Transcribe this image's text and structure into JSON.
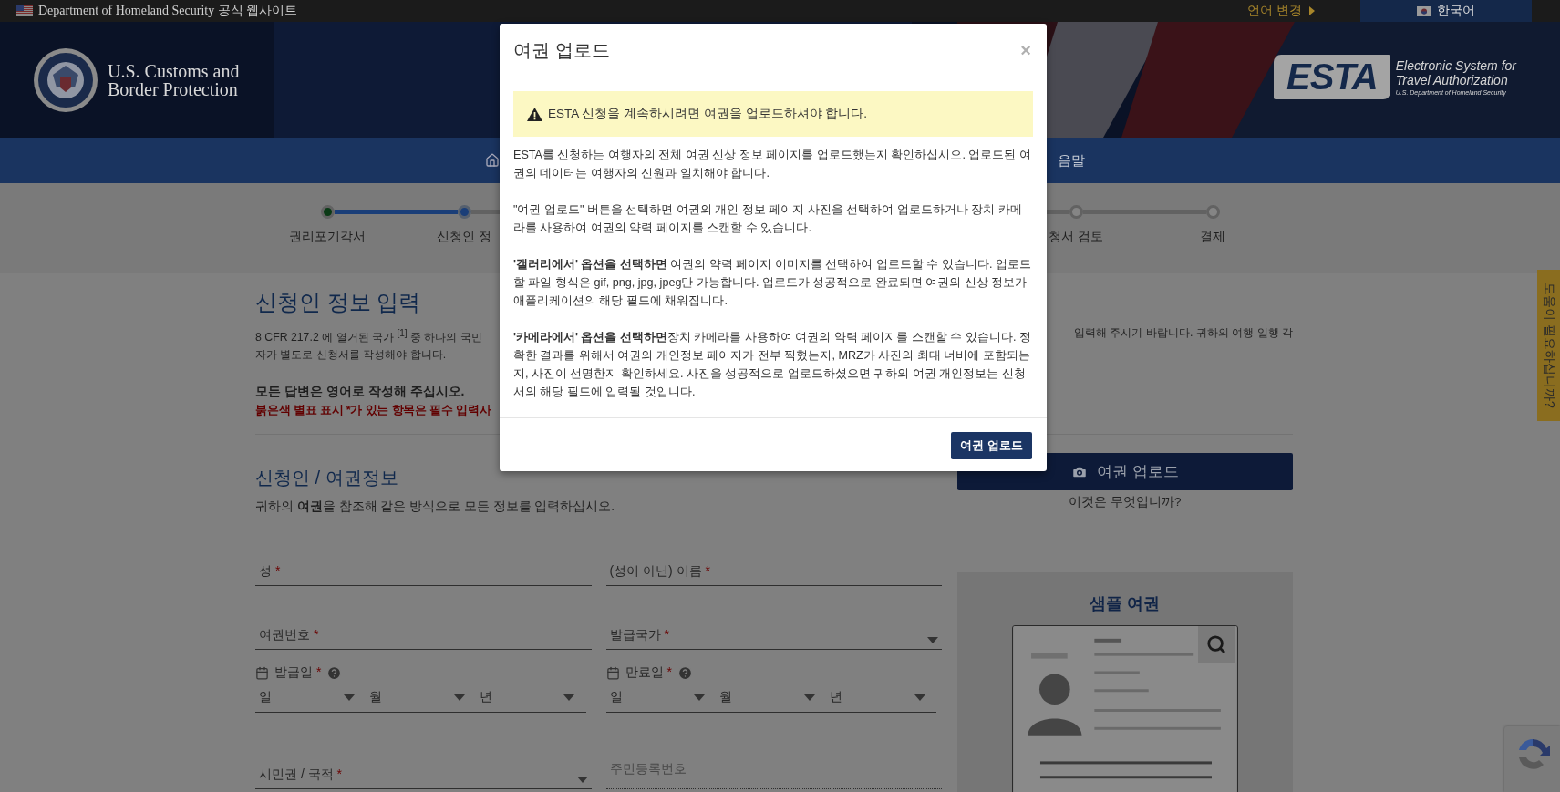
{
  "top_bar": {
    "site_label": "Department of Homeland Security 공식 웹사이트",
    "language_change": "언어 변경",
    "language": "한국어"
  },
  "header": {
    "agency_name": [
      "U.S. Customs and",
      "Border Protection"
    ],
    "esta_logo": {
      "mark": "ESTA",
      "tagline": [
        "Electronic System for",
        "Travel Authorization"
      ],
      "department": "U.S. Department of Homeland Security"
    }
  },
  "nav": {
    "item_fragment": "음말"
  },
  "steps": [
    {
      "label": "권리포기각서",
      "done": true,
      "selected": false
    },
    {
      "label": "신청인 정",
      "done": false,
      "selected": true
    },
    {
      "label": "청서 검토",
      "done": false,
      "selected": false
    },
    {
      "label": "결제",
      "done": false,
      "selected": false
    }
  ],
  "page": {
    "title": "신청인 정보 입력",
    "intro": {
      "line_1_left": "8 CFR 217.2 에 열거된 국가 $^{[1]}$ 중 하나의 국민",
      "line_1_right": "입력해 주시기 바랍니다. 귀하의 여행 일행 각",
      "line_2": "자가 별도로 신청서를 작성해야 합니다."
    },
    "notice": "모든 답변은 영어로 작성해 주십시오.",
    "required_note": "붉은색 별표 표시 *가 있는 항목은 필수 입력사"
  },
  "section": {
    "title": "신청인 / 여권정보",
    "subtitle": "귀하의 **여권**을 참조해 같은 방식으로 모든 정보를 입력하십시오."
  },
  "upload": {
    "button": "여권 업로드",
    "help_link": "이것은 무엇입니까?"
  },
  "fields": [
    {
      "kind": "text",
      "label": "성",
      "required_mark": "*"
    },
    {
      "kind": "text",
      "label": "(성이 아닌) 이름",
      "required_mark": "*"
    },
    {
      "kind": "text",
      "label": "여권번호",
      "required_mark": "*"
    },
    {
      "kind": "select",
      "label": "발급국가",
      "required_mark": "*"
    },
    {
      "kind": "date",
      "label": "발급일",
      "required_mark": "*",
      "parts": [
        "일",
        "월",
        "년"
      ]
    },
    {
      "kind": "date",
      "label": "만료일",
      "required_mark": "*",
      "parts": [
        "일",
        "월",
        "년"
      ]
    },
    {
      "kind": "select",
      "label": "시민권 / 국적",
      "required_mark": "*"
    },
    {
      "kind": "placeholder",
      "placeholder": "주민등록번호"
    }
  ],
  "sample_passport": {
    "title": "샘플 여권"
  },
  "help_tab": "도움이 필요하십니까?",
  "modal": {
    "title": "여권 업로드",
    "close": "×",
    "alert": "ESTA 신청을 계속하시려면 여권을 업로드하셔야 합니다.",
    "paragraphs": [
      "ESTA를 신청하는 여행자의 전체 여권 신상 정보 페이지를 업로드했는지 확인하십시오.  업로드된 여권의 데이터는 여행자의 신원과 일치해야 합니다.",
      "\"여권 업로드\" 버튼을 선택하면 여권의 개인 정보 페이지 사진을 선택하여 업로드하거나 장치 카메라를 사용하여 여권의 약력 페이지를 스캔할 수 있습니다.",
      "**'갤러리에서' 옵션을 선택하면** 여권의 약력 페이지 이미지를 선택하여 업로드할 수 있습니다. 업로드할 파일 형식은 gif, png, jpg, jpeg만 가능합니다. 업로드가 성공적으로 완료되면 여권의 신상 정보가 애플리케이션의 해당 필드에 채워집니다.",
      "**'카메라에서' 옵션을 선택하면**장치 카메라를 사용하여 여권의 약력 페이지를 스캔할 수 있습니다. 정확한 결과를 위해서 여권의 개인정보 페이지가 전부 찍혔는지, MRZ가 사진의 최대 너비에 포함되는지, 사진이 선명한지 확인하세요. 사진을 성공적으로 업로드하셨으면 귀하의 여권 개인정보는 신청서의 해당 필드에 입력될 것입니다."
    ],
    "button": "여권 업로드"
  }
}
